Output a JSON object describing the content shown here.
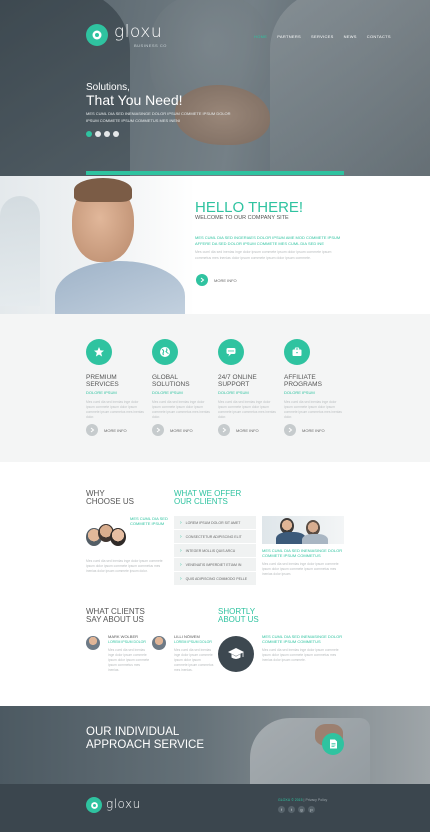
{
  "brand": {
    "name": "gloxu",
    "tagline": "BUSINESS CO"
  },
  "nav": {
    "items": [
      "HOME",
      "PARTNERS",
      "SERVICES",
      "NEWS",
      "CONTACTS"
    ]
  },
  "hero": {
    "subtitle": "Solutions,",
    "title": "That You Need!",
    "text": "MES CUML DIA SED INENIASINGE DOLOR IPSUM COMMETE IPSUM DOLOR IPSUM COMMETE IPSUM COMMETUS MES INENI",
    "slides": [
      {
        "active": true
      },
      {
        "active": false
      },
      {
        "active": false
      },
      {
        "active": false
      }
    ]
  },
  "hello": {
    "title": "HELLO THERE!",
    "subtitle": "WELCOME TO OUR COMPANY SITE",
    "accent": "MES CUML DIA SED INGERIAES DOLOR IPSUM AME MOD COMMETE IPSUM AFFERE DA SED DOLOR IPSUM COMMETE MES CUML DIA SED INE",
    "body": "Mes cuml dia sed inenias inge dolor ipsum commete ipsum dolor ipsum commete ipsum commetus mes inenias dolor ipsum commete ipsum dolor ipsum commete.",
    "more_label": "MORE INFO"
  },
  "services": {
    "items": [
      {
        "title_1": "PREMIUM",
        "title_2": "SERVICES",
        "sub": "DOLORE IPSUM",
        "icon": "star-icon",
        "text": "Mes cuml dia sed inenias inge dolor ipsum commete ipsum dolor ipsum commete ipsum commetus mes inenias dolor.",
        "more_label": "MORE INFO"
      },
      {
        "title_1": "GLOBAL",
        "title_2": "SOLUTIONS",
        "sub": "DOLORE IPSUM",
        "icon": "globe-icon",
        "text": "Mes cuml dia sed inenias inge dolor ipsum commete ipsum dolor ipsum commete ipsum commetus mes inenias dolor.",
        "more_label": "MORE INFO"
      },
      {
        "title_1": "24/7 ONLINE",
        "title_2": "SUPPORT",
        "sub": "DOLORE IPSUM",
        "icon": "chat-icon",
        "text": "Mes cuml dia sed inenias inge dolor ipsum commete ipsum dolor ipsum commete ipsum commetus mes inenias dolor.",
        "more_label": "MORE INFO"
      },
      {
        "title_1": "AFFILIATE",
        "title_2": "PROGRAMS",
        "sub": "DOLORE IPSUM",
        "icon": "briefcase-icon",
        "text": "Mes cuml dia sed inenias inge dolor ipsum commete ipsum dolor ipsum commete ipsum commetus mes inenias dolor.",
        "more_label": "MORE INFO"
      }
    ]
  },
  "why": {
    "title_1": "WHY",
    "title_2": "CHOOSE US",
    "accent": "MES CUML DIA SED COMMETE IPSUM",
    "text": "Mes cuml dia sed inenias inge dolor ipsum commete ipsum dolor ipsum commete ipsum commetus mes inenias dolor ipsum commete ipsum dolor."
  },
  "offer": {
    "title_1": "WHAT WE OFFER",
    "title_2": "OUR CLIENTS",
    "items": [
      "LOREM IPSUM DOLOR SIT AMET",
      "CONSECTETUR ADIPISCING ELIT",
      "INTEGER MOLLIS QUIS ARCU",
      "VENENATIS IMPERDIET ETIAM IN",
      "QUIS ADIPISCING COMMODO PELLE"
    ],
    "side_accent": "MES CUML DIA SED INENIASINGE DOLOR COMMETE IPSUM COMMETUS",
    "side_text": "Mes cuml dia sed inenias inge dolor ipsum commete ipsum dolor ipsum commete ipsum commetus mes inenias dolor ipsum."
  },
  "clients": {
    "title_1": "WHAT CLIENTS",
    "title_2": "SAY ABOUT US",
    "items": [
      {
        "name": "MARK WOLBER",
        "role": "LOREM IPSUM DOLOR",
        "text": "Mes cuml dia sed inenias inge dolor ipsum commete ipsum dolor ipsum commete ipsum commetus mes inenias."
      },
      {
        "name": "LILLI NÖWEM",
        "role": "LOREM IPSUM DOLOR",
        "text": "Mes cuml dia sed inenias inge dolor ipsum commete ipsum dolor ipsum commete ipsum commetus mes inenias."
      }
    ]
  },
  "shortly": {
    "title_1": "SHORTLY",
    "title_2": "ABOUT US",
    "accent": "MES CUML DIA SED INENIASINGE DOLOR COMMETE IPSUM COMMETUS",
    "text": "Mes cuml dia sed inenias inge dolor ipsum commete ipsum dolor ipsum commete ipsum commetus mes inenias dolor ipsum commete."
  },
  "approach": {
    "title_1": "OUR INDIVIDUAL",
    "title_2": "APPROACH SERVICE"
  },
  "footer": {
    "brand": "gloxu",
    "copyright": "GLOXU © 2015",
    "policy": "Privacy Policy",
    "social": [
      "f",
      "t",
      "g",
      "p"
    ]
  },
  "colors": {
    "accent": "#2fc3a0",
    "dark": "#3b464e"
  }
}
